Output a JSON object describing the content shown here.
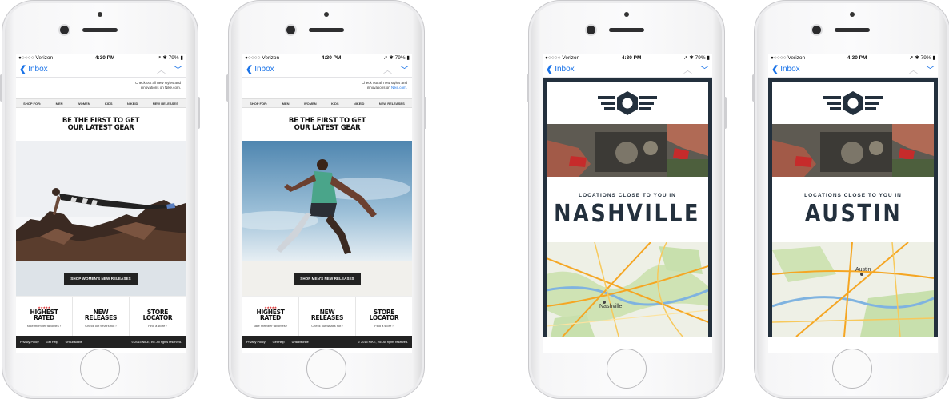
{
  "status_bar": {
    "carrier": "●○○○○ Verizon",
    "time": "4:30 PM",
    "battery": "79%"
  },
  "nav": {
    "back_label": "Inbox"
  },
  "nike": {
    "promo_line1": "Check out all new styles and",
    "promo_line2": "innovations on",
    "promo_link": "Nike.com.",
    "nav_items": [
      "SHOP FOR:",
      "MEN",
      "WOMEN",
      "KIDS",
      "NIKEID",
      "NEW RELEASES"
    ],
    "headline_line1": "BE THE FIRST TO GET",
    "headline_line2": "OUR LATEST GEAR",
    "shop_women": "SHOP WOMEN'S NEW RELEASES",
    "shop_men": "SHOP MEN'S NEW RELEASES",
    "stars": "★★★★★",
    "features": [
      {
        "title_line1": "HIGHEST",
        "title_line2": "RATED",
        "sub": "Nike member favorites ›"
      },
      {
        "title_line1": "NEW",
        "title_line2": "RELEASES",
        "sub": "Check out what's hot ›"
      },
      {
        "title_line1": "STORE",
        "title_line2": "LOCATOR",
        "sub": "Find a store ›"
      }
    ],
    "footer": {
      "privacy": "Privacy Policy",
      "help": "Get Help",
      "unsubscribe": "Unsubscribe",
      "copyright": "© 2015 NIKE, Inc. All rights reserved."
    }
  },
  "auto": {
    "subtitle": "LOCATIONS CLOSE TO YOU IN",
    "city_1": "NASHVILLE",
    "city_2": "AUSTIN",
    "map_label_1": "Nashville",
    "map_label_2": "Austin"
  },
  "colors": {
    "ios_blue": "#1a73e8",
    "auto_navy": "#23303d",
    "nike_black": "#222222",
    "star_red": "#dd3333"
  }
}
